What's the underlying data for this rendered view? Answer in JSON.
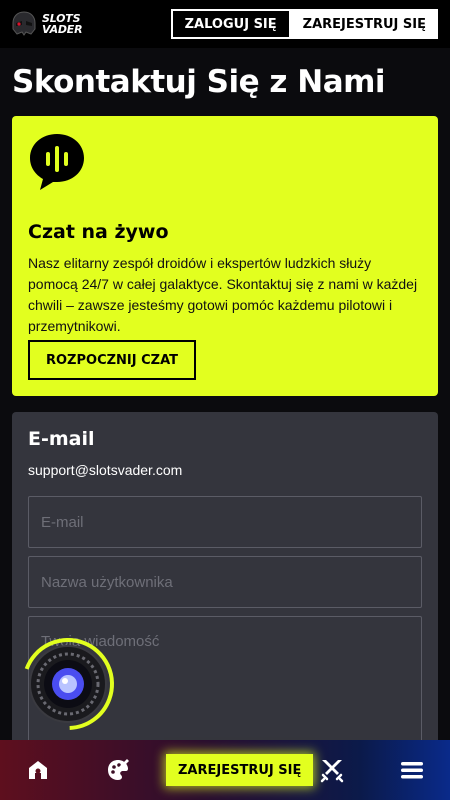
{
  "header": {
    "logo_line1": "SLOTS",
    "logo_line2": "VADER",
    "login_label": "ZALOGUJ SIĘ",
    "register_label": "ZAREJESTRUJ SIĘ"
  },
  "page": {
    "title": "Skontaktuj Się z Nami"
  },
  "live_chat": {
    "icon": "chat-bubble-icon",
    "title": "Czat na żywo",
    "description": "Nasz elitarny zespół droidów i ekspertów ludzkich służy pomocą 24/7 w całej galaktyce. Skontaktuj się z nami w każdej chwili – zawsze jesteśmy gotowi pomóc każdemu pilotowi i przemytnikowi.",
    "button_label": "ROZPOCZNIJ CZAT"
  },
  "email_section": {
    "title": "E-mail",
    "address": "support@slotsvader.com",
    "email_placeholder": "E-mail",
    "username_placeholder": "Nazwa użytkownika",
    "message_placeholder": "Twoja wiadomość"
  },
  "bottom_nav": {
    "home_icon": "home-icon",
    "games_icon": "games-icon",
    "register_label": "ZAREJESTRUJ SIĘ",
    "swords_icon": "crossed-swords-icon",
    "menu_icon": "menu-icon"
  },
  "colors": {
    "accent": "#e2ff1f",
    "card_dark": "#34353d",
    "background": "#0b0b0e"
  }
}
